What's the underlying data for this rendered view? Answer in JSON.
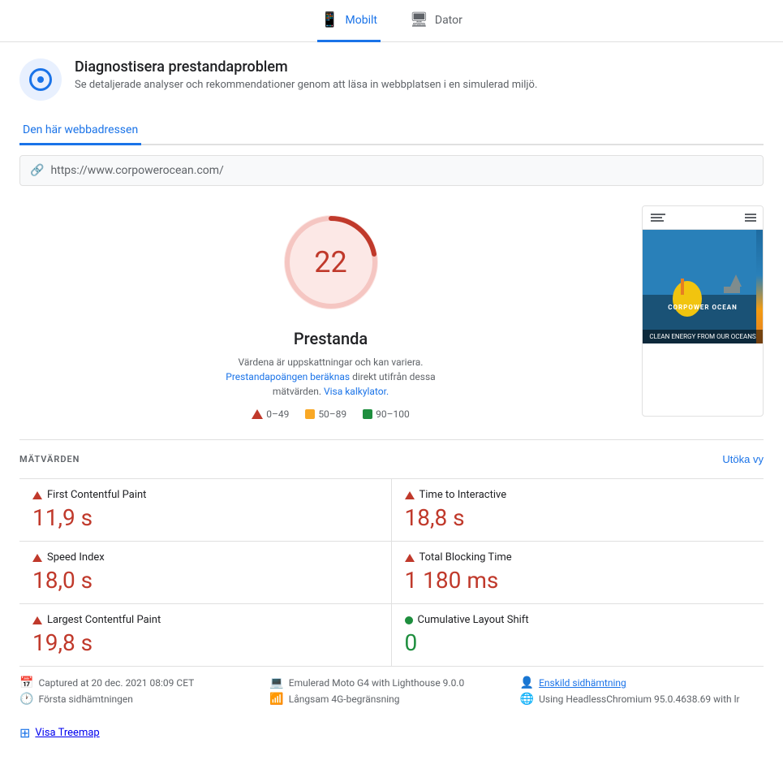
{
  "tabs": {
    "mobile_label": "Mobilt",
    "desktop_label": "Dator",
    "active": "mobile"
  },
  "diagnostics": {
    "title": "Diagnostisera prestandaproblem",
    "description": "Se detaljerade analyser och rekommendationer genom att läsa in webbplatsen i en simulerad miljö."
  },
  "url_tab": {
    "label": "Den här webbadressen"
  },
  "url": {
    "value": "https://www.corpowerocean.com/"
  },
  "score": {
    "value": "22",
    "label": "Prestanda",
    "desc_text": "Värdena är uppskattningar och kan variera.",
    "link1_text": "Prestandapoängen beräknas",
    "link1_after": "direkt utifrån dessa mätvärden.",
    "link2_text": "Visa kalkylator.",
    "legend": {
      "bad_label": "0–49",
      "medium_label": "50–89",
      "good_label": "90–100"
    }
  },
  "preview": {
    "logo_text": "CORPOWER\nOCEAN",
    "caption": "CLEAN ENERGY FROM\nOUR OCEANS"
  },
  "metrics_section": {
    "title": "MÄTVÄRDEN",
    "expand_btn": "Utöka vy",
    "items": [
      {
        "name": "First Contentful Paint",
        "value": "11,9 s",
        "status": "bad"
      },
      {
        "name": "Time to Interactive",
        "value": "18,8 s",
        "status": "bad"
      },
      {
        "name": "Speed Index",
        "value": "18,0 s",
        "status": "bad"
      },
      {
        "name": "Total Blocking Time",
        "value": "1 180 ms",
        "status": "bad"
      },
      {
        "name": "Largest Contentful Paint",
        "value": "19,8 s",
        "status": "bad"
      },
      {
        "name": "Cumulative Layout Shift",
        "value": "0",
        "status": "good"
      }
    ]
  },
  "footer": {
    "captured_label": "Captured at 20 dec. 2021 08:09 CET",
    "first_fetch_label": "Första sidhämtningen",
    "emulated_label": "Emulerad Moto G4 with Lighthouse 9.0.0",
    "network_label": "Långsam 4G-begränsning",
    "single_fetch_label": "Enskild sidhämtning",
    "browser_label": "Using HeadlessChromium 95.0.4638.69 with lr"
  },
  "treemap": {
    "label": "Visa Treemap"
  }
}
